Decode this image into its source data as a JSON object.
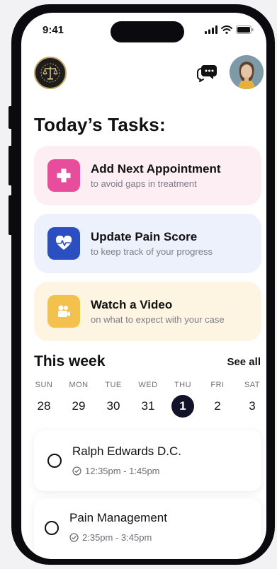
{
  "status_bar": {
    "time": "9:41"
  },
  "header": {
    "logo_icon": "scales-of-justice-icon",
    "chat_icon": "chat-bubble-icon"
  },
  "page_title": "Today’s Tasks:",
  "tasks": [
    {
      "title": "Add Next Appointment",
      "subtitle": "to avoid gaps in treatment",
      "icon": "medical-cross-icon",
      "bg": "#fdeef4",
      "icon_bg": "#e84d9c"
    },
    {
      "title": "Update Pain Score",
      "subtitle": "to keep track of your progress",
      "icon": "heart-pulse-icon",
      "bg": "#edf1fb",
      "icon_bg": "#2b4fc1"
    },
    {
      "title": "Watch a Video",
      "subtitle": "on what to expect with your case",
      "icon": "video-camera-icon",
      "bg": "#fdf4e2",
      "icon_bg": "#f2c14e"
    }
  ],
  "week": {
    "title": "This week",
    "see_all": "See all",
    "days": [
      {
        "name": "SUN",
        "num": "28"
      },
      {
        "name": "MON",
        "num": "29"
      },
      {
        "name": "TUE",
        "num": "30"
      },
      {
        "name": "WED",
        "num": "31"
      },
      {
        "name": "THU",
        "num": "1",
        "selected": true
      },
      {
        "name": "FRI",
        "num": "2"
      },
      {
        "name": "SAT",
        "num": "3"
      }
    ]
  },
  "appointments": [
    {
      "title": "Ralph Edwards D.C.",
      "time": "12:35pm - 1:45pm"
    },
    {
      "title": "Pain Management",
      "time": "2:35pm - 3:45pm"
    }
  ]
}
